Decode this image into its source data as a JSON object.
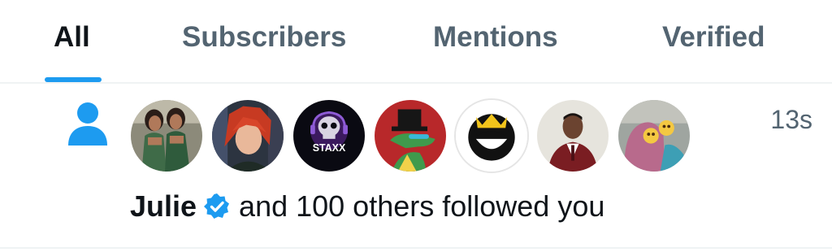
{
  "tabs": [
    {
      "label": "All",
      "active": true
    },
    {
      "label": "Subscribers",
      "active": false
    },
    {
      "label": "Mentions",
      "active": false
    },
    {
      "label": "Verified",
      "active": false
    }
  ],
  "colors": {
    "accent": "#1d9bf0",
    "text_primary": "#0f1419",
    "text_secondary": "#536471",
    "divider": "#eff3f4"
  },
  "notification": {
    "icon": "person-icon",
    "timestamp": "13s",
    "user_name": "Julie",
    "verified_icon": "verified-badge-icon",
    "message": "and 100 others followed you",
    "avatar_count": 7
  }
}
